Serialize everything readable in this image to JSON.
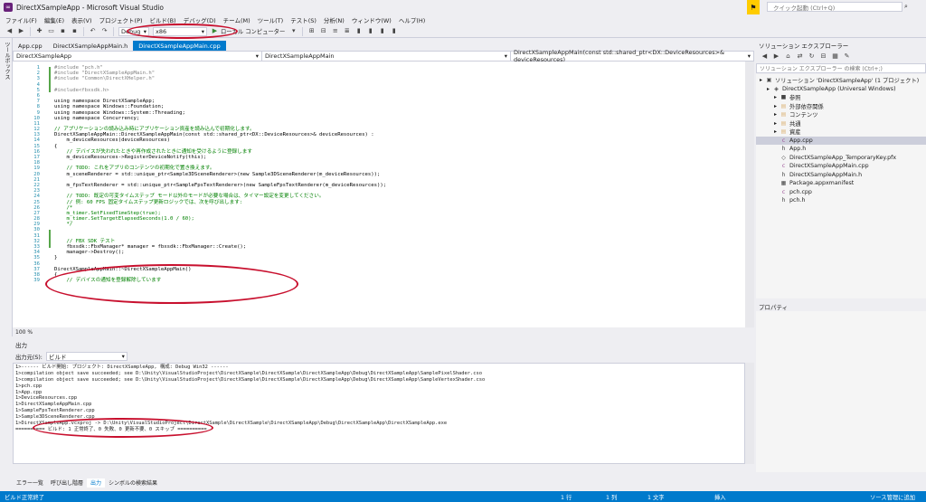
{
  "window": {
    "title": "DirectXSampleApp - Microsoft Visual Studio"
  },
  "quick_launch": {
    "placeholder": "クイック起動 (Ctrl+Q)"
  },
  "menu": [
    "ファイル(F)",
    "編集(E)",
    "表示(V)",
    "プロジェクト(P)",
    "ビルド(B)",
    "デバッグ(D)",
    "チーム(M)",
    "ツール(T)",
    "テスト(S)",
    "分析(N)",
    "ウィンドウ(W)",
    "ヘルプ(H)"
  ],
  "toolbar": {
    "config": "Debug",
    "platform": "x86",
    "run_target": "ローカル コンピューター"
  },
  "left_strip": {
    "label": "ツールボックス"
  },
  "tabs": [
    {
      "label": "App.cpp",
      "active": false
    },
    {
      "label": "DirectXSampleAppMain.h",
      "active": false
    },
    {
      "label": "DirectXSampleAppMain.cpp",
      "active": true
    }
  ],
  "navbar": {
    "project": "DirectXSampleApp",
    "scope": "DirectXSampleAppMain",
    "member": "DirectXSampleAppMain(const std::shared_ptr<DX::DeviceResources>& deviceResources)"
  },
  "editor": {
    "zoom": "100 %",
    "lines": [
      {
        "n": "1",
        "t": "#include \"pch.h\"",
        "c": "pp"
      },
      {
        "n": "2",
        "t": "#include \"DirectXSampleAppMain.h\"",
        "c": "pp"
      },
      {
        "n": "3",
        "t": "#include \"Common\\DirectXHelper.h\"",
        "c": "pp"
      },
      {
        "n": "4",
        "t": "",
        "c": ""
      },
      {
        "n": "5",
        "t": "#include<fbxsdk.h>",
        "c": "pp"
      },
      {
        "n": "6",
        "t": "",
        "c": ""
      },
      {
        "n": "7",
        "t": "using namespace DirectXSampleApp;",
        "c": ""
      },
      {
        "n": "8",
        "t": "using namespace Windows::Foundation;",
        "c": ""
      },
      {
        "n": "9",
        "t": "using namespace Windows::System::Threading;",
        "c": ""
      },
      {
        "n": "10",
        "t": "using namespace Concurrency;",
        "c": ""
      },
      {
        "n": "11",
        "t": "",
        "c": ""
      },
      {
        "n": "12",
        "t": "// アプリケーションの読み込み時にアプリケーション資産を読み込んで初期化します。",
        "c": "cmt"
      },
      {
        "n": "13",
        "t": "DirectXSampleAppMain::DirectXSampleAppMain(const std::shared_ptr<DX::DeviceResources>& deviceResources) :",
        "c": ""
      },
      {
        "n": "14",
        "t": "    m_deviceResources(deviceResources)",
        "c": ""
      },
      {
        "n": "15",
        "t": "{",
        "c": ""
      },
      {
        "n": "16",
        "t": "    // デバイスが失われたときや再作成されたときに通知を受けるように登録します",
        "c": "cmt"
      },
      {
        "n": "17",
        "t": "    m_deviceResources->RegisterDeviceNotify(this);",
        "c": ""
      },
      {
        "n": "18",
        "t": "",
        "c": ""
      },
      {
        "n": "19",
        "t": "    // TODO: これをアプリのコンテンツの初期化で置き換えます。",
        "c": "cmt"
      },
      {
        "n": "20",
        "t": "    m_sceneRenderer = std::unique_ptr<Sample3DSceneRenderer>(new Sample3DSceneRenderer(m_deviceResources));",
        "c": ""
      },
      {
        "n": "21",
        "t": "",
        "c": ""
      },
      {
        "n": "22",
        "t": "    m_fpsTextRenderer = std::unique_ptr<SampleFpsTextRenderer>(new SampleFpsTextRenderer(m_deviceResources));",
        "c": ""
      },
      {
        "n": "23",
        "t": "",
        "c": ""
      },
      {
        "n": "24",
        "t": "    // TODO: 既定の可変タイムステップ モード以外のモードが必要な場合は、タイマー設定を変更してください。",
        "c": "cmt"
      },
      {
        "n": "25",
        "t": "    // 例: 60 FPS 固定タイムステップ更新ロジックでは、次を呼び出します:",
        "c": "cmt"
      },
      {
        "n": "26",
        "t": "    /*",
        "c": "cmt"
      },
      {
        "n": "27",
        "t": "    m_timer.SetFixedTimeStep(true);",
        "c": "cmt"
      },
      {
        "n": "28",
        "t": "    m_timer.SetTargetElapsedSeconds(1.0 / 60);",
        "c": "cmt"
      },
      {
        "n": "29",
        "t": "    */",
        "c": "cmt"
      },
      {
        "n": "30",
        "t": "",
        "c": ""
      },
      {
        "n": "31",
        "t": "",
        "c": ""
      },
      {
        "n": "32",
        "t": "    // FBX SDK テスト",
        "c": "cmt"
      },
      {
        "n": "33",
        "t": "    fbxsdk::FbxManager* manager = fbxsdk::FbxManager::Create();",
        "c": ""
      },
      {
        "n": "34",
        "t": "    manager->Destroy();",
        "c": ""
      },
      {
        "n": "35",
        "t": "}",
        "c": ""
      },
      {
        "n": "36",
        "t": "",
        "c": ""
      },
      {
        "n": "37",
        "t": "DirectXSampleAppMain::~DirectXSampleAppMain()",
        "c": ""
      },
      {
        "n": "38",
        "t": "{",
        "c": ""
      },
      {
        "n": "39",
        "t": "    // デバイスの通知を登録解除しています",
        "c": "cmt"
      }
    ]
  },
  "solution_explorer": {
    "title": "ソリューション エクスプローラー",
    "search_placeholder": "ソリューション エクスプローラー の検索 (Ctrl+;)",
    "nodes": [
      {
        "label": "ソリューション 'DirectXSampleApp' (1 プロジェクト)",
        "indent": 0,
        "icon": "solution-icon",
        "glyph": "▣",
        "sel": false
      },
      {
        "label": "DirectXSampleApp (Universal Windows)",
        "indent": 1,
        "icon": "project-icon",
        "glyph": "◈",
        "sel": false
      },
      {
        "label": "参照",
        "indent": 2,
        "icon": "references-icon",
        "glyph": "■",
        "sel": false
      },
      {
        "label": "外部依存関係",
        "indent": 2,
        "icon": "folder-icon",
        "glyph": "▤",
        "sel": false
      },
      {
        "label": "コンテンツ",
        "indent": 2,
        "icon": "folder-icon",
        "glyph": "▤",
        "sel": false
      },
      {
        "label": "共通",
        "indent": 2,
        "icon": "folder-icon",
        "glyph": "▤",
        "sel": false
      },
      {
        "label": "資産",
        "indent": 2,
        "icon": "folder-icon",
        "glyph": "▤",
        "sel": false
      },
      {
        "label": "App.cpp",
        "indent": 2,
        "icon": "cpp-file-icon",
        "glyph": "c",
        "sel": true
      },
      {
        "label": "App.h",
        "indent": 2,
        "icon": "header-file-icon",
        "glyph": "h",
        "sel": false
      },
      {
        "label": "DirectXSampleApp_TemporaryKey.pfx",
        "indent": 2,
        "icon": "key-file-icon",
        "glyph": "◇",
        "sel": false
      },
      {
        "label": "DirectXSampleAppMain.cpp",
        "indent": 2,
        "icon": "cpp-file-icon",
        "glyph": "c",
        "sel": false
      },
      {
        "label": "DirectXSampleAppMain.h",
        "indent": 2,
        "icon": "header-file-icon",
        "glyph": "h",
        "sel": false
      },
      {
        "label": "Package.appxmanifest",
        "indent": 2,
        "icon": "manifest-file-icon",
        "glyph": "▦",
        "sel": false
      },
      {
        "label": "pch.cpp",
        "indent": 2,
        "icon": "cpp-file-icon",
        "glyph": "c",
        "sel": false
      },
      {
        "label": "pch.h",
        "indent": 2,
        "icon": "header-file-icon",
        "glyph": "h",
        "sel": false
      }
    ]
  },
  "properties": {
    "title": "プロパティ"
  },
  "output": {
    "title": "出力",
    "source_label": "出力元(S):",
    "source_value": "ビルド",
    "lines": [
      "1>------ ビルド開始: プロジェクト: DirectXSampleApp, 構成: Debug Win32 ------",
      "1>compilation object save succeeded; see D:\\Unity\\VisualStudioProject\\DirectXSample\\DirectXSample\\DirectXSampleApp\\Debug\\DirectXSampleApp\\SamplePixelShader.cso",
      "1>compilation object save succeeded; see D:\\Unity\\VisualStudioProject\\DirectXSample\\DirectXSample\\DirectXSampleApp\\Debug\\DirectXSampleApp\\SampleVertexShader.cso",
      "1>pch.cpp",
      "1>App.cpp",
      "1>DeviceResources.cpp",
      "1>DirectXSampleAppMain.cpp",
      "1>SampleFpsTextRenderer.cpp",
      "1>Sample3DSceneRenderer.cpp",
      "1>DirectXSampleApp.vcxproj -> D:\\Unity\\VisualStudioProject\\DirectXSample\\DirectXSample\\DirectXSampleApp\\Debug\\DirectXSampleApp\\DirectXSampleApp.exe",
      "========== ビルド: 1 正常終了、0 失敗、0 更新不要、0 スキップ =========="
    ]
  },
  "bottom_tabs": [
    {
      "label": "エラー一覧",
      "active": false
    },
    {
      "label": "呼び出し階層",
      "active": false
    },
    {
      "label": "出力",
      "active": true
    },
    {
      "label": "シンボルの検索結果",
      "active": false
    }
  ],
  "status": {
    "message": "ビルド正常終了",
    "line": "1 行",
    "col": "1 列",
    "ch": "1 文字",
    "mode": "挿入",
    "scm": "ソース管理に追加"
  },
  "colors": {
    "accent": "#007ACC",
    "annotation": "#C8102E",
    "notification": "#FFCC00"
  }
}
